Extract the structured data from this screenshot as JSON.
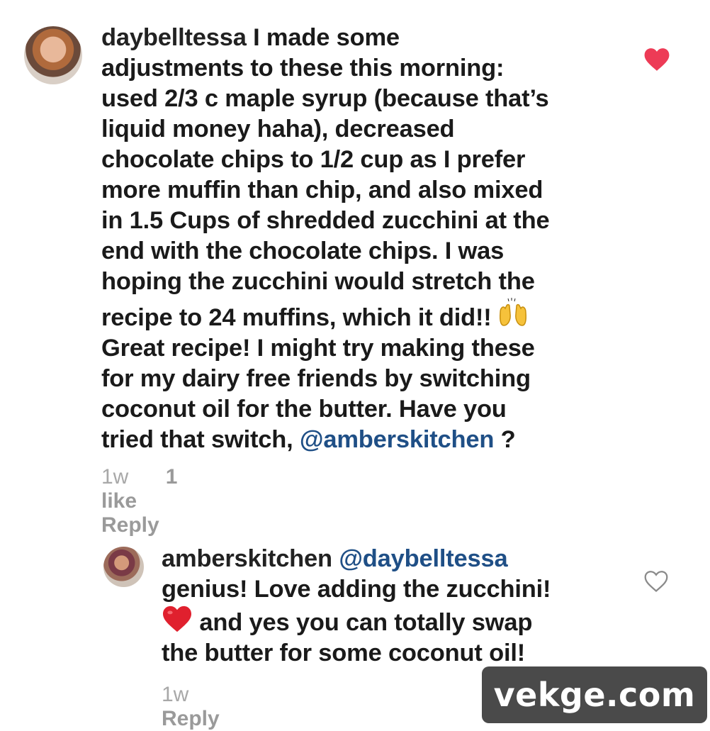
{
  "comment": {
    "username": "daybelltessa",
    "text_1": " I made some\nadjustments to these this morning:\nused 2/3 c maple syrup (because that’s\nliquid money haha), decreased\nchocolate chips to 1/2 cup as I prefer\nmore muffin than chip, and also mixed\nin 1.5 Cups of shredded zucchini at the\nend with the chocolate chips. I was\nhoping the zucchini would stretch the\nrecipe to 24 muffins, which it did!! ",
    "text_2": "\nGreat recipe! I might try making these\nfor my dairy free friends by switching\ncoconut oil for the butter. Have you\ntried that switch, ",
    "mention": "@amberskitchen",
    "text_3": " ?",
    "time": "1w",
    "likes": "1 like",
    "reply_label": "Reply",
    "liked": true,
    "like_color": "#ed3b56"
  },
  "reply": {
    "username": "amberskitchen",
    "mention": "@daybelltessa",
    "text_1": "\ngenius! Love adding the zucchini!\n",
    "text_2": " and yes you can totally swap\nthe butter for some coconut oil!",
    "time": "1w",
    "reply_label": "Reply",
    "liked": false
  },
  "icons": {
    "raised_hands": "raised-hands-emoji",
    "red_heart": "red-heart-emoji",
    "like": "heart-icon"
  },
  "watermark": "vekge.com"
}
